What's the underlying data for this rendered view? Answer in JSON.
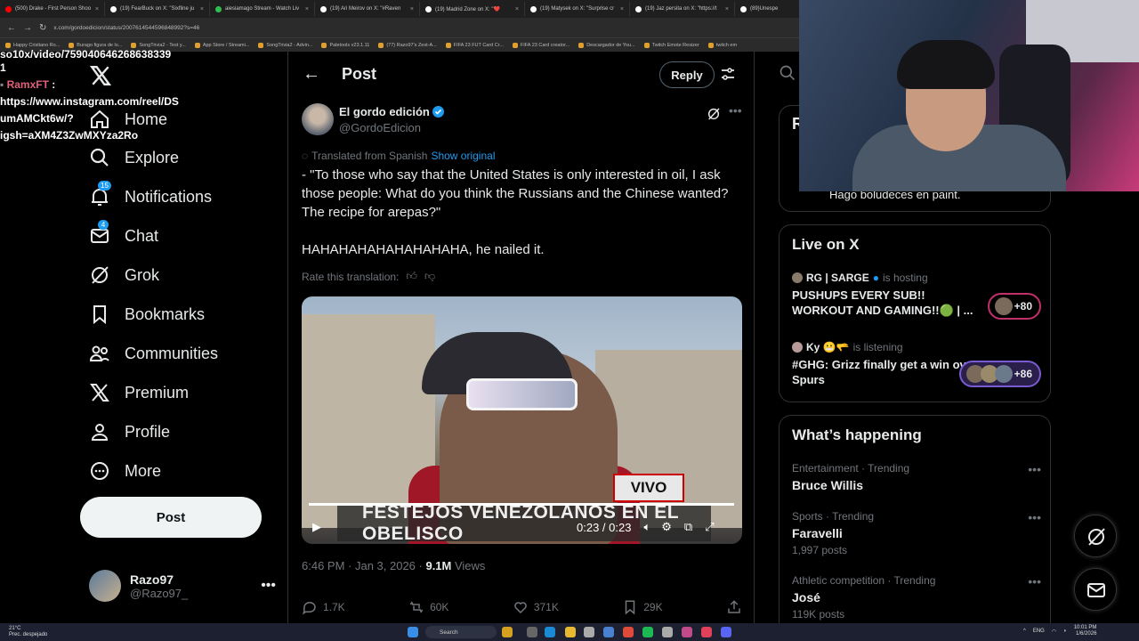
{
  "browser": {
    "tabs": [
      {
        "title": "(500) Drake - First Person Shoo",
        "color": "#ff0000"
      },
      {
        "title": "(19) FearBuck on X: \"Sixfline ju",
        "color": "#ffffff"
      },
      {
        "title": "aiesiamago Stream - Watch Liv",
        "color": "#2fbf4f"
      },
      {
        "title": "(19) Ari Meirov on X: \"#Raven",
        "color": "#ffffff"
      },
      {
        "title": "(19) Madrid Zone on X: \"❤️",
        "color": "#ffffff"
      },
      {
        "title": "(19) Matysek on X: \"Surprise cr",
        "color": "#ffffff"
      },
      {
        "title": "(19) Jaz persita on X: \"https://t",
        "color": "#ffffff"
      },
      {
        "title": "(89)Unespe",
        "color": "#ffffff"
      }
    ],
    "url": "x.com/gordoedicion/status/2007614544596848992?s=46",
    "bookmarks": [
      "Happy Cristiano Ro...",
      "Burago figura de lo...",
      "SongTrivia2 - Test y...",
      "App Store / Streami...",
      "SongTrivia2 - Advin...",
      "Paletools v23.1.11",
      "(77) Razo97's Zest-A...",
      "FIFA 23 FUT Card Cr...",
      "FIFA 23 Card creator...",
      "Descargador de You...",
      "Twitch Emote Resizer",
      "twitch em"
    ]
  },
  "chat_overlay": {
    "line1": "so10x/video/759040646268638339",
    "line2": "1",
    "user": "RamxFT",
    "msg1": "https://www.instagram.com/reel/DS",
    "msg2": "umAMCkt6w/?",
    "msg3": "igsh=aXM4Z3ZwMXYza2Ro"
  },
  "nav": {
    "home": "Home",
    "explore": "Explore",
    "notifications": "Notifications",
    "notifications_badge": "15",
    "chat": "Chat",
    "chat_badge": "4",
    "grok": "Grok",
    "bookmarks": "Bookmarks",
    "communities": "Communities",
    "premium": "Premium",
    "profile": "Profile",
    "more": "More",
    "post_button": "Post"
  },
  "account": {
    "name": "Razo97",
    "handle": "@Razo97_"
  },
  "post_header": {
    "title": "Post",
    "reply": "Reply"
  },
  "post": {
    "author_name": "El gordo edición",
    "author_handle": "@GordoEdicion",
    "translated_label": "Translated from Spanish",
    "show_original": "Show original",
    "text1": "- \"To those who say that the United States is only interested in oil, I ask those people: What do you think the Russians and the Chinese wanted? The recipe for arepas?\"",
    "text2": "HAHAHAHAHAHAHAHAHA, he nailed it.",
    "rate_label": "Rate this translation:",
    "video_badge": "VIVO",
    "video_caption": "FESTEJOS VENEZOLANOS EN EL OBELISCO",
    "video_time": "0:23 / 0:23",
    "video_progress": 1.0,
    "timestamp": "6:46 PM · Jan 3, 2026 · ",
    "views_count": "9.1M",
    "views_label": " Views",
    "replies": "1.7K",
    "reposts": "60K",
    "likes": "371K",
    "bookmarks": "29K"
  },
  "right": {
    "card_letter": "R",
    "card_text": "Hago boludeces en paint.",
    "live_title": "Live on X",
    "live": [
      {
        "host": "RG | SARGE",
        "status": "is hosting",
        "title": "PUSHUPS EVERY SUB!! WORKOUT AND GAMING!!🟢 | ...",
        "count": "+80"
      },
      {
        "host": "Ky 😬🫳",
        "status": "is listening",
        "title": "#GHG: Grizz finally get a win over Spurs",
        "count": "+86"
      }
    ],
    "happening_title": "What’s happening",
    "trends": [
      {
        "category": "Entertainment · Trending",
        "name": "Bruce Willis",
        "count": ""
      },
      {
        "category": "Sports · Trending",
        "name": "Faravelli",
        "count": "1,997 posts"
      },
      {
        "category": "Athletic competition · Trending",
        "name": "José",
        "count": "119K posts"
      }
    ]
  },
  "taskbar": {
    "weather_temp": "21°C",
    "weather_desc": "Prec. despejado",
    "search": "Search",
    "lang": "ENG",
    "time": "10:01 PM",
    "date": "1/6/2026"
  },
  "colors": {
    "accent": "#1d9bf0",
    "live_pill": "#c0306a"
  }
}
